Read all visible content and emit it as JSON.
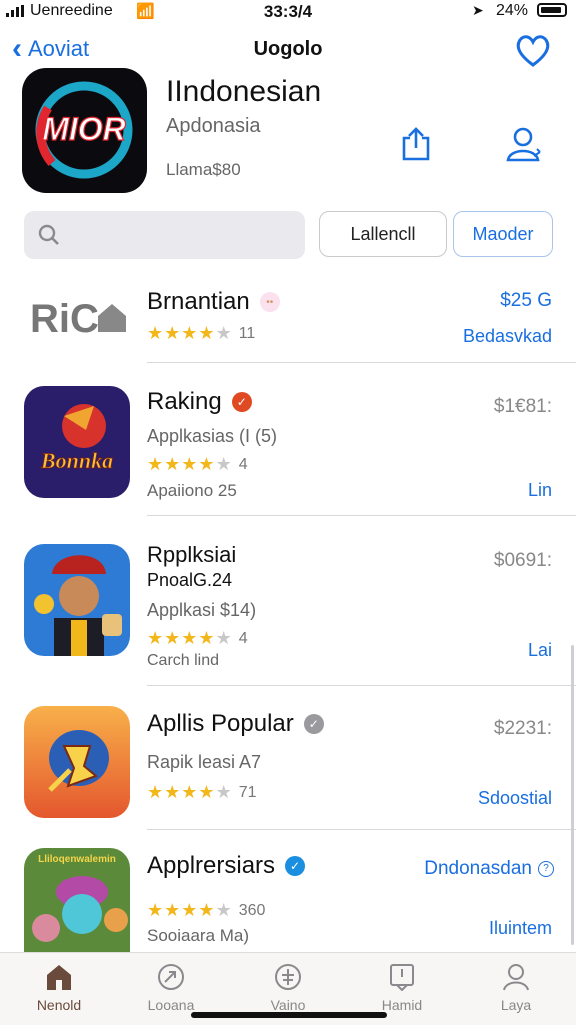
{
  "status_bar": {
    "carrier": "Uenreedine",
    "time": "33:3/4",
    "battery": "24%"
  },
  "nav": {
    "back_label": "Aoviat",
    "title": "Uogolo"
  },
  "hero": {
    "icon_text": "MIOR",
    "title": "IIndonesian",
    "subtitle": "Apdonasia",
    "price": "Llama$80"
  },
  "search": {
    "placeholder": ""
  },
  "filters": {
    "left": "Lallencll",
    "right": "Maoder"
  },
  "apps": [
    {
      "name": "Brnantian",
      "icon_text": "RiC",
      "rating_count": "11",
      "price": "$25 G",
      "action": "Bedasvkad"
    },
    {
      "name": "Raking",
      "icon_text": "Bonnka",
      "subtitle": "Applkasias (I (5)",
      "rating_count": "4",
      "detail": "Apaiiono 25",
      "price": "$1€81:",
      "action": "Lin"
    },
    {
      "name": "Rpplksiai",
      "name2": "PnoalG.24",
      "subtitle": "Applkasi $14)",
      "rating_count": "4",
      "detail": "Carch lind",
      "price": "$0691:",
      "action": "Lai"
    },
    {
      "name": "Apllis Popular",
      "subtitle": "Rapik leasi A7",
      "rating_count": "71",
      "price": "$2231:",
      "action": "Sdoostial"
    },
    {
      "name": "Applrersiars",
      "icon_text": "Lliloqenwalemin",
      "rating_count": "360",
      "detail": "Sooiaara Ma)",
      "price": "Dndonasdan",
      "action": "Iluintem"
    }
  ],
  "tabs": [
    {
      "label": "Nenold",
      "icon": "home-icon"
    },
    {
      "label": "Looana",
      "icon": "games-icon"
    },
    {
      "label": "Vaino",
      "icon": "apps-icon"
    },
    {
      "label": "Hamid",
      "icon": "updates-icon"
    },
    {
      "label": "Laya",
      "icon": "profile-icon"
    }
  ],
  "colors": {
    "accent": "#1a6fe0",
    "star": "#f2b71a"
  }
}
